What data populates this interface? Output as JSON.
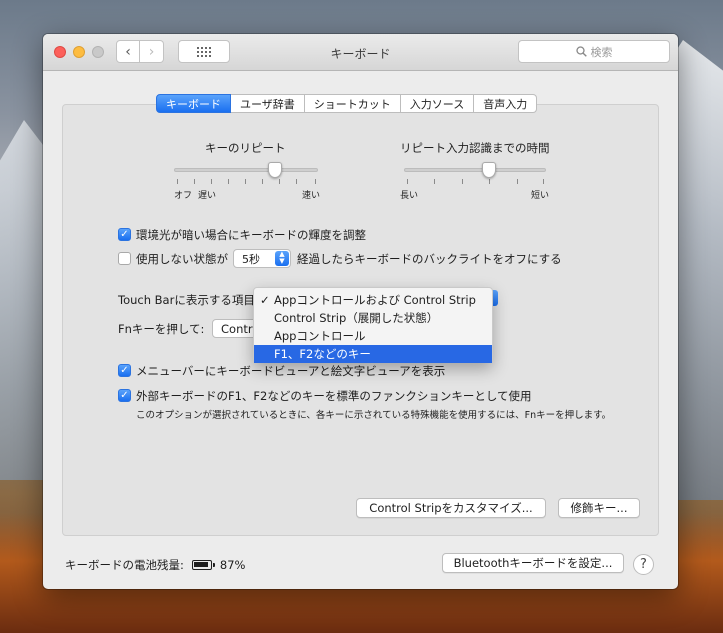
{
  "window": {
    "title": "キーボード",
    "search_placeholder": "検索"
  },
  "tabs": [
    {
      "label": "キーボード",
      "active": true
    },
    {
      "label": "ユーザ辞書"
    },
    {
      "label": "ショートカット"
    },
    {
      "label": "入力ソース"
    },
    {
      "label": "音声入力"
    }
  ],
  "key_repeat": {
    "title": "キーのリピート",
    "label_off": "オフ",
    "label_slow": "遅い",
    "label_fast": "速い",
    "level": 0.7
  },
  "repeat_delay": {
    "title": "リピート入力認識までの時間",
    "label_long": "長い",
    "label_short": "短い",
    "level": 0.6
  },
  "options": {
    "ambient_brightness": {
      "label": "環境光が暗い場合にキーボードの輝度を調整",
      "checked": true
    },
    "backlight_off": {
      "label_before": "使用しない状態が",
      "value": "5秒",
      "label_after": "経過したらキーボードのバックライトをオフにする",
      "checked": false
    }
  },
  "touch_bar": {
    "label": "Touch Barに表示する項目:"
  },
  "fn_key": {
    "label": "Fnキーを押して:",
    "value": "Contro"
  },
  "touch_bar_menu": {
    "items": [
      {
        "label": "Appコントロールおよび Control Strip",
        "checked": true
      },
      {
        "label": "Control Strip（展開した状態）"
      },
      {
        "label": "Appコントロール"
      },
      {
        "label": "F1、F2などのキー",
        "highlighted": true
      }
    ]
  },
  "menu_bar_viewer": {
    "label": "メニューバーにキーボードビューアと絵文字ビューアを表示",
    "checked": true
  },
  "function_keys": {
    "label": "外部キーボードのF1、F2などのキーを標準のファンクションキーとして使用",
    "checked": true,
    "note": "このオプションが選択されているときに、各キーに示されている特殊機能を使用するには、Fnキーを押します。"
  },
  "buttons": {
    "customize": "Control Stripをカスタマイズ...",
    "modifier": "修飾キー...",
    "bluetooth": "Bluetoothキーボードを設定..."
  },
  "battery": {
    "label": "キーボードの電池残量:",
    "value": "87%"
  },
  "colors": {
    "accent": "#1a6ff0",
    "menu_highlight": "#2868e4"
  }
}
